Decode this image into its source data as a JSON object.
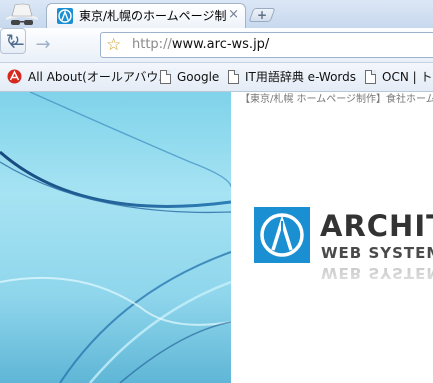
{
  "tab": {
    "title": "東京/札幌のホームページ制…",
    "close": "×"
  },
  "toolbar": {
    "back_icon": "←",
    "forward_icon": "→",
    "reload_icon": "↻",
    "star_icon": "☆"
  },
  "omnibox": {
    "scheme": "http://",
    "host": "www.arc-ws.jp/"
  },
  "bookmarks": [
    {
      "label": "All About(オールアバウ...",
      "icon": "allabout-icon"
    },
    {
      "label": "Google",
      "icon": "page-icon"
    },
    {
      "label": "IT用語辞典 e-Words",
      "icon": "page-icon"
    },
    {
      "label": "OCN | トッ",
      "icon": "page-icon"
    }
  ],
  "page": {
    "tagline": "【東京/札幌 ホームページ制作】食社ホームページ",
    "logo_line1": "ARCHITEC",
    "logo_line2": "WEB SYSTEM",
    "brand_color": "#1a8fd1"
  }
}
